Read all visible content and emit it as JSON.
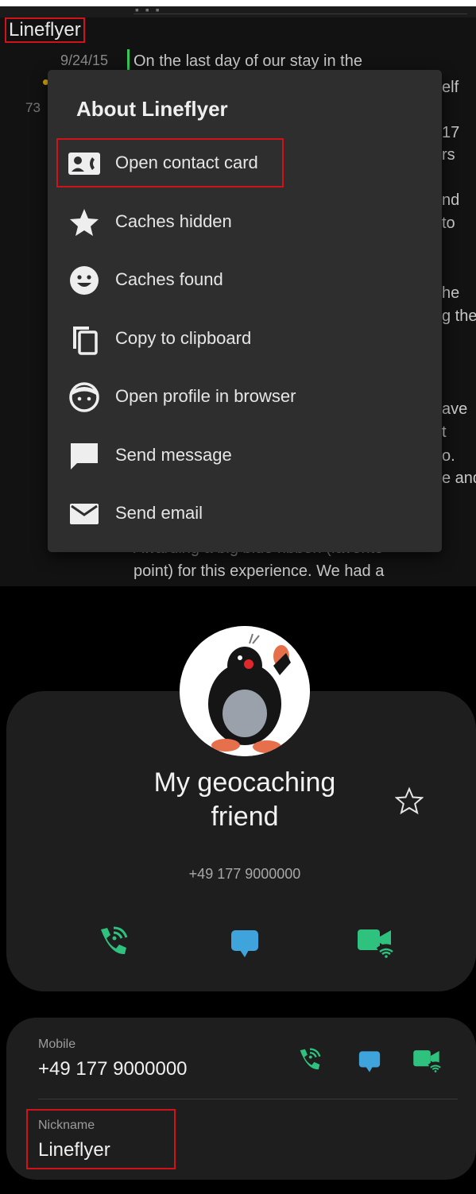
{
  "log": {
    "top_glyph": "▪ ▪ ▪",
    "author": "Lineflyer",
    "date": "9/24/15",
    "side_number": "73",
    "lines": [
      {
        "text": "On the last day of our stay in the"
      },
      {
        "text": "elf"
      },
      {
        "text": "17"
      },
      {
        "text": "rs"
      },
      {
        "text": "nd"
      },
      {
        "text": "to"
      },
      {
        "text": "he"
      },
      {
        "text": "g the"
      },
      {
        "text": "ave"
      },
      {
        "text": "t"
      },
      {
        "text": "o."
      },
      {
        "text": "e and"
      },
      {
        "text": "Awarding a big blue ribbon (favorite"
      },
      {
        "text": "point) for this experience. We had a"
      }
    ]
  },
  "popup": {
    "title": "About Lineflyer",
    "items": [
      {
        "label": "Open contact card",
        "icon": "contact-card-icon"
      },
      {
        "label": "Caches hidden",
        "icon": "star-icon"
      },
      {
        "label": "Caches found",
        "icon": "smiley-icon"
      },
      {
        "label": "Copy to clipboard",
        "icon": "copy-icon"
      },
      {
        "label": "Open profile in browser",
        "icon": "profile-face-icon"
      },
      {
        "label": "Send message",
        "icon": "message-icon"
      },
      {
        "label": "Send email",
        "icon": "email-icon"
      }
    ]
  },
  "contact": {
    "name_line1": "My geocaching",
    "name_line2": "friend",
    "phone": "+49 177 9000000",
    "actions": [
      {
        "icon": "wifi-call-icon"
      },
      {
        "icon": "chat-bubble-icon"
      },
      {
        "icon": "video-call-icon"
      }
    ],
    "fields": {
      "mobile_label": "Mobile",
      "mobile_value": "+49 177 9000000",
      "nickname_label": "Nickname",
      "nickname_value": "Lineflyer"
    }
  },
  "colors": {
    "highlight": "#d0121b",
    "call_green": "#2ec27e",
    "chat_blue": "#3fa3dc",
    "popup_bg": "#2e2e2e",
    "card_bg": "#1e1e1e"
  }
}
